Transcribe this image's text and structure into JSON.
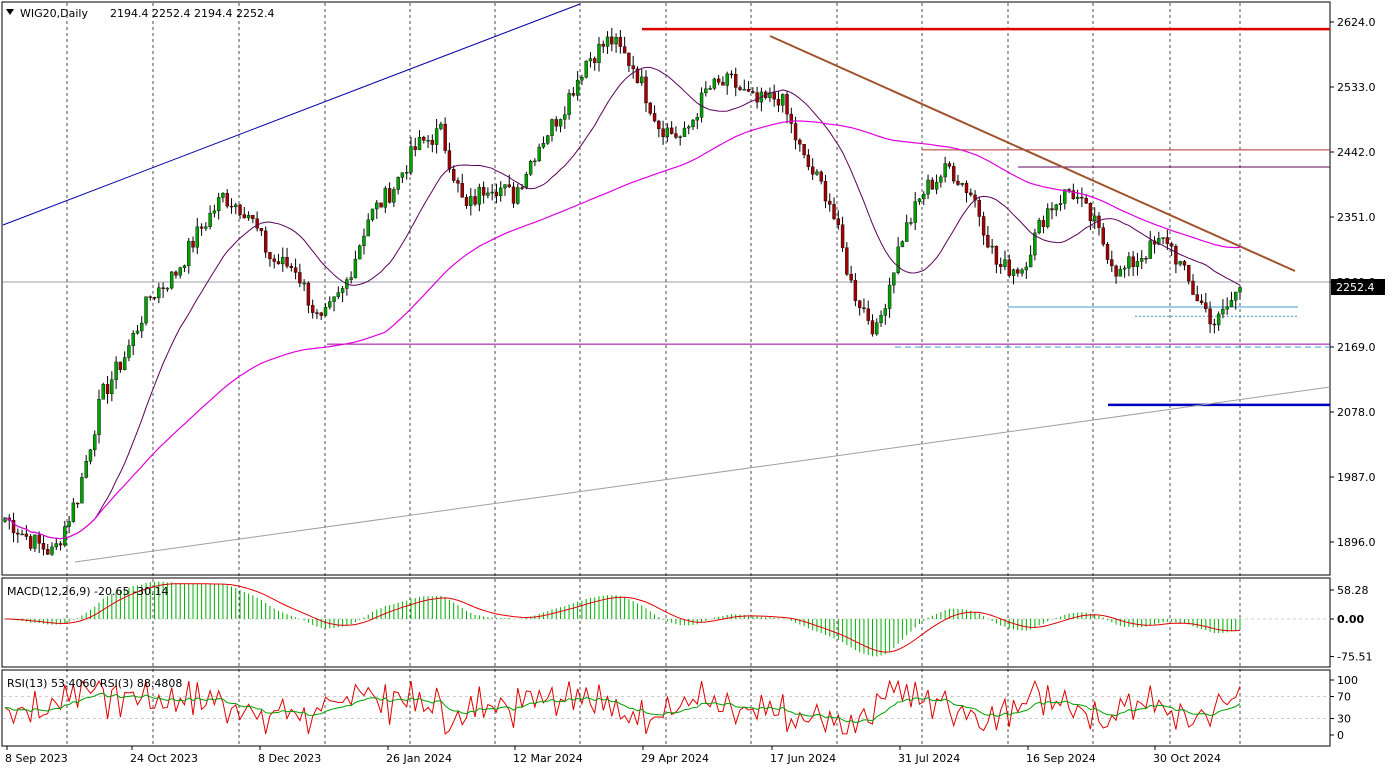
{
  "header": {
    "symbol": "WIG20,Daily",
    "ohlc": "2194.4 2252.4 2194.4 2252.4"
  },
  "colors": {
    "bull": "#00a000",
    "bear": "#a00000",
    "sma_fast": "#5a005a",
    "sma_slow": "#e000e0",
    "trend_down": "#a0522d",
    "resistance": "#e00000",
    "support": "#0000c0",
    "channel": "#0000aa",
    "macd_hist": "#00b000",
    "macd_signal": "#e00000",
    "rsi_fast": "#e00000",
    "rsi_slow": "#00a000"
  },
  "chart_data": [
    {
      "type": "candlestick",
      "name": "WIG20 Daily",
      "y_ticks": [
        1896.0,
        1987.0,
        2078.0,
        2169.0,
        2260.0,
        2351.0,
        2442.0,
        2533.0,
        2624.0
      ],
      "y_tick_labels": [
        "1896.0",
        "1987.0",
        "2078.0",
        "2169.0",
        "2260.0",
        "2351.0",
        "2442.0",
        "2533.0",
        "2624.0"
      ],
      "last_price_label": "2252.4",
      "last_price": 2252.4,
      "x_labels": [
        "8 Sep 2023",
        "24 Oct 2023",
        "8 Dec 2023",
        "26 Jan 2024",
        "12 Mar 2024",
        "29 Apr 2024",
        "17 Jun 2024",
        "31 Jul 2024",
        "16 Sep 2024",
        "30 Oct 2024"
      ],
      "key_levels": {
        "resistance": 2614.0,
        "upper_lines": [
          2445.0,
          2421.0
        ],
        "support_mid": 2173.0,
        "support_low": 2088.0
      },
      "close_path": [
        1930,
        1900,
        1880,
        1960,
        2100,
        2160,
        2240,
        2270,
        2330,
        2380,
        2360,
        2290,
        2280,
        2200,
        2250,
        2350,
        2390,
        2450,
        2470,
        2360,
        2400,
        2380,
        2450,
        2500,
        2570,
        2600,
        2560,
        2480,
        2460,
        2530,
        2540,
        2510,
        2520,
        2430,
        2380,
        2250,
        2190,
        2320,
        2390,
        2420,
        2380,
        2280,
        2280,
        2360,
        2390,
        2340,
        2270,
        2300,
        2320,
        2250,
        2200,
        2252
      ]
    },
    {
      "type": "macd",
      "label": "MACD(12,26,9) -20.65 -30.14",
      "y_tick_labels": [
        "58.28",
        "0.00",
        "-75.51"
      ],
      "y_ticks": [
        58.28,
        0.0,
        -75.51
      ]
    },
    {
      "type": "rsi",
      "label": "RSI(13) 53.4060  RSI(3) 88.4808",
      "y_tick_labels": [
        "100",
        "70",
        "30",
        "0"
      ],
      "y_ticks": [
        100,
        70,
        30,
        0
      ]
    }
  ]
}
